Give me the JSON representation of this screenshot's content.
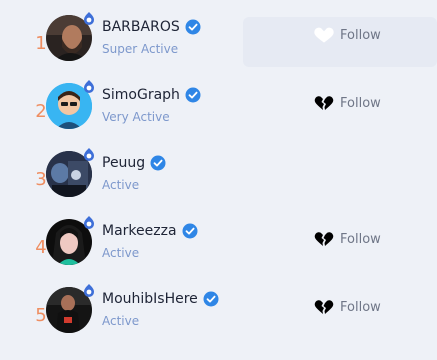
{
  "follow_list": {
    "follow_label": "Follow",
    "users": [
      {
        "rank": "1",
        "name": "BARBAROS",
        "status": "Super Active",
        "verified": true,
        "follow_icon": "heart-outline-icon",
        "follow_state": "hover"
      },
      {
        "rank": "2",
        "name": "SimoGraph",
        "status": "Very Active",
        "verified": true,
        "follow_icon": "broken-heart-icon",
        "follow_state": "default"
      },
      {
        "rank": "3",
        "name": "Peuug",
        "status": "Active",
        "verified": true,
        "follow_icon": "",
        "follow_state": "hidden"
      },
      {
        "rank": "4",
        "name": "Markeezza",
        "status": "Active",
        "verified": true,
        "follow_icon": "broken-heart-icon",
        "follow_state": "default"
      },
      {
        "rank": "5",
        "name": "MouhibIsHere",
        "status": "Active",
        "verified": true,
        "follow_icon": "broken-heart-icon",
        "follow_state": "default"
      }
    ]
  },
  "colors": {
    "background": "#eef1f7",
    "rank": "#ee8e62",
    "status": "#7d98cc",
    "verified": "#2f86e6",
    "badge": "#3e6fd8"
  }
}
